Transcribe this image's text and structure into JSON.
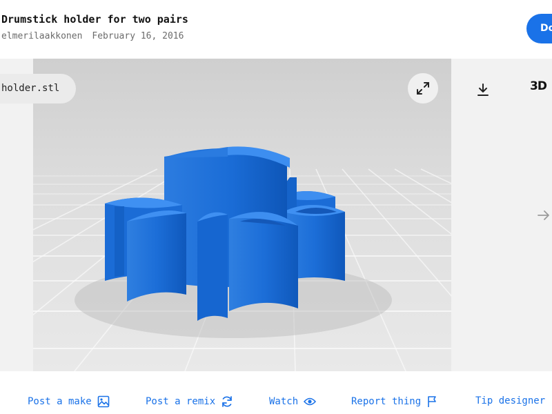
{
  "header": {
    "title": "Drumstick holder for two pairs",
    "author": "elmerilaakkonen",
    "date": "February 16, 2016",
    "download_label": "Download"
  },
  "viewer": {
    "file_name": "holder.stl",
    "mode_label": "3D",
    "icons": [
      "expand-icon",
      "download-icon",
      "arrow-right-icon"
    ],
    "model_color": "#1a6fd9",
    "floor_color": "#d7d7d7"
  },
  "actions": [
    {
      "label": "Post a make",
      "icon": "image-icon"
    },
    {
      "label": "Post a remix",
      "icon": "refresh-icon"
    },
    {
      "label": "Watch",
      "icon": "eye-icon"
    },
    {
      "label": "Report thing",
      "icon": "flag-icon"
    },
    {
      "label": "Tip designer",
      "icon": "tip-icon"
    }
  ],
  "colors": {
    "accent": "#1a72e8",
    "muted_text": "#6b6b6b"
  }
}
